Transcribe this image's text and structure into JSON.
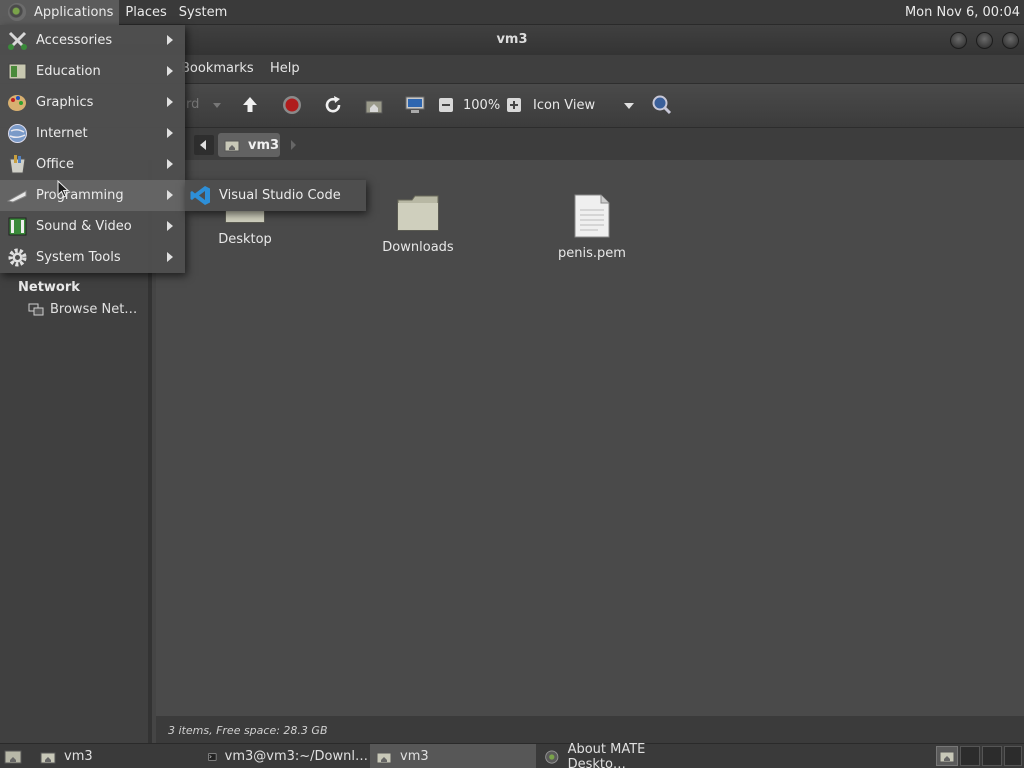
{
  "top_panel": {
    "menus": [
      "Applications",
      "Places",
      "System"
    ],
    "clock": "Mon Nov  6, 00:04"
  },
  "window": {
    "title": "vm3",
    "menubar": [
      "Bookmarks",
      "Help"
    ],
    "toolbar": {
      "back_fragment": "rd",
      "zoom": "100%",
      "view_mode": "Icon View"
    },
    "location": {
      "path_button": "vm3"
    },
    "sidebar": {
      "network_heading": "Network",
      "browse_network": "Browse Net…"
    },
    "files": [
      {
        "name": "Desktop",
        "icon": "folder-icon"
      },
      {
        "name": "Downloads",
        "icon": "folder-icon"
      },
      {
        "name": "penis.pem",
        "icon": "document-icon"
      }
    ],
    "status": "3 items, Free space: 28.3 GB"
  },
  "applications_menu": {
    "items": [
      {
        "label": "Accessories",
        "icon": "accessories-icon"
      },
      {
        "label": "Education",
        "icon": "education-icon"
      },
      {
        "label": "Graphics",
        "icon": "graphics-icon"
      },
      {
        "label": "Internet",
        "icon": "internet-icon"
      },
      {
        "label": "Office",
        "icon": "office-icon"
      },
      {
        "label": "Programming",
        "icon": "programming-icon"
      },
      {
        "label": "Sound & Video",
        "icon": "sound-video-icon"
      },
      {
        "label": "System Tools",
        "icon": "system-tools-icon"
      }
    ],
    "active_item": "Programming",
    "submenu": [
      {
        "label": "Visual Studio Code",
        "icon": "vscode-icon"
      }
    ]
  },
  "taskbar": {
    "tasks": [
      {
        "label": "vm3",
        "icon": "folder-icon"
      },
      {
        "label": "vm3@vm3:~/Downl…",
        "icon": "terminal-icon"
      },
      {
        "label": "vm3",
        "icon": "folder-icon"
      },
      {
        "label": "About MATE Deskto…",
        "icon": "mate-icon"
      }
    ]
  },
  "colors": {
    "menu_bg": "#4e4e4e",
    "highlight": "#646464",
    "panel_bg": "#3a3a3a",
    "content_bg": "#4a4a4a"
  }
}
